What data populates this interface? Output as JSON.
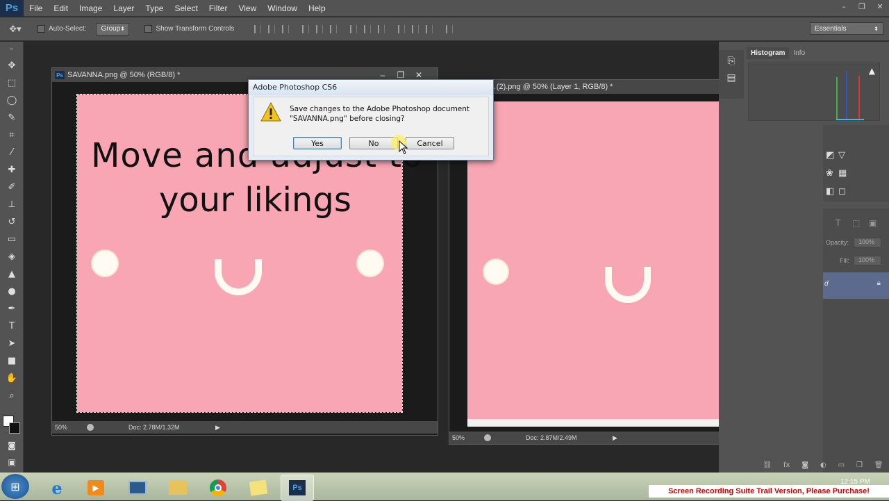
{
  "app": {
    "logo": "Ps"
  },
  "menu": [
    "File",
    "Edit",
    "Image",
    "Layer",
    "Type",
    "Select",
    "Filter",
    "View",
    "Window",
    "Help"
  ],
  "window_controls": {
    "min": "–",
    "max": "❐",
    "close": "✕"
  },
  "options": {
    "auto_select_label": "Auto-Select:",
    "group_value": "Group",
    "transform_label": "Show Transform Controls"
  },
  "workspace": "Essentials",
  "tools": [
    {
      "name": "move-tool-icon",
      "glyph": "✥"
    },
    {
      "name": "marquee-tool-icon",
      "glyph": "⬚"
    },
    {
      "name": "lasso-tool-icon",
      "glyph": "◯"
    },
    {
      "name": "quick-select-tool-icon",
      "glyph": "✎"
    },
    {
      "name": "crop-tool-icon",
      "glyph": "⌗"
    },
    {
      "name": "eyedropper-tool-icon",
      "glyph": "⁄"
    },
    {
      "name": "healing-tool-icon",
      "glyph": "✚"
    },
    {
      "name": "brush-tool-icon",
      "glyph": "✐"
    },
    {
      "name": "stamp-tool-icon",
      "glyph": "⊥"
    },
    {
      "name": "history-brush-tool-icon",
      "glyph": "↺"
    },
    {
      "name": "eraser-tool-icon",
      "glyph": "▭"
    },
    {
      "name": "bucket-tool-icon",
      "glyph": "◈"
    },
    {
      "name": "blur-tool-icon",
      "glyph": "▲"
    },
    {
      "name": "dodge-tool-icon",
      "glyph": "●"
    },
    {
      "name": "pen-tool-icon",
      "glyph": "✒"
    },
    {
      "name": "type-tool-icon",
      "glyph": "T"
    },
    {
      "name": "path-select-tool-icon",
      "glyph": "➤"
    },
    {
      "name": "shape-tool-icon",
      "glyph": "■"
    },
    {
      "name": "hand-tool-icon",
      "glyph": "✋"
    },
    {
      "name": "zoom-tool-icon",
      "glyph": "⌕"
    }
  ],
  "doc1": {
    "title": "SAVANNA.png @ 50% (RGB/8) *",
    "text_line1": "Move and adjust to",
    "text_line2": "your likings",
    "zoom": "50%",
    "doc_info": "Doc: 2.78M/1.32M"
  },
  "doc2": {
    "title": "A (2).png @ 50% (Layer 1, RGB/8) *",
    "zoom": "50%",
    "doc_info": "Doc: 2.87M/2.49M"
  },
  "panels": {
    "tabs": [
      "Histogram",
      "Info"
    ],
    "opacity_label": "Opacity:",
    "opacity_value": "100%",
    "fill_label": "Fill:",
    "fill_value": "100%",
    "layer_name_fragment": "d"
  },
  "dialog": {
    "title": "Adobe Photoshop CS6",
    "message_line1": "Save changes to the Adobe Photoshop document",
    "message_line2": "\"SAVANNA.png\" before closing?",
    "yes": "Yes",
    "no": "No",
    "cancel": "Cancel"
  },
  "taskbar": {
    "clock": "12:15 PM",
    "watermark": "Screen Recording Suite Trail Version, Please Purchase!"
  }
}
